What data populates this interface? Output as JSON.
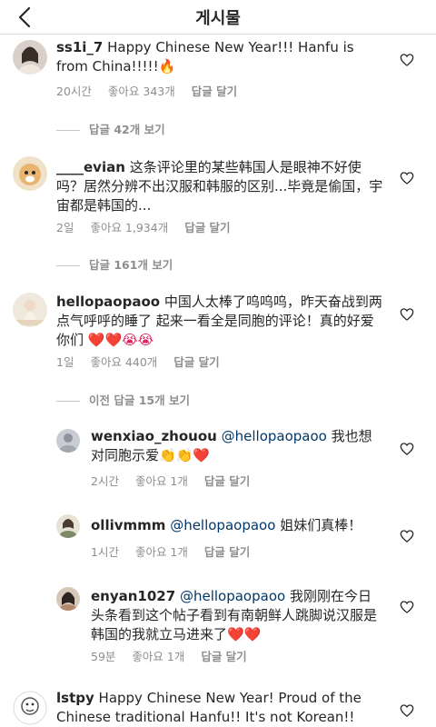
{
  "header": {
    "title": "게시물"
  },
  "comments": [
    {
      "username": "ss1i_7",
      "text": "Happy Chinese New Year!!! Hanfu is from China!!!!!",
      "emoji": "🔥",
      "time": "20시간",
      "likes": "좋아요 343개",
      "reply": "답글 달기",
      "view_replies": "답글 42개 보기"
    },
    {
      "username": "____evian",
      "text": "这条评论里的某些韩国人是眼神不好使吗？居然分辨不出汉服和韩服的区别...毕竟是偷国，宇宙都是韩国的...",
      "time": "2일",
      "likes": "좋아요 1,934개",
      "reply": "답글 달기",
      "view_replies": "답글 161개 보기"
    },
    {
      "username": "hellopaopaoo",
      "text": "中国人太棒了呜呜呜，昨天奋战到两点气呼呼的睡了 起来一看全是同胞的评论！真的好爱你们",
      "emoji": "❤️❤️😭😭",
      "time": "1일",
      "likes": "좋아요 440개",
      "reply": "답글 달기",
      "view_replies": "이전 답글 15개 보기"
    },
    {
      "username": "lstpy",
      "text": "Happy Chinese New Year! Proud of the Chinese traditional Hanfu!! It's not Korean!!"
    }
  ],
  "replies": [
    {
      "username": "wenxiao_zhouou",
      "mention": "@hellopaopaoo",
      "text": "我也想对同胞示爱",
      "emoji": "👏👏❤️",
      "time": "2시간",
      "likes": "좋아요 1개",
      "reply": "답글 달기"
    },
    {
      "username": "ollivmmm",
      "mention": "@hellopaopaoo",
      "text": "姐妹们真棒！",
      "time": "1시간",
      "likes": "좋아요 1개",
      "reply": "답글 달기"
    },
    {
      "username": "enyan1027",
      "mention": "@hellopaopaoo",
      "text": "我刚刚在今日头条看到这个帖子看到有南朝鲜人跳脚说汉服是韩国的我就立马进来了",
      "emoji": "❤️❤️",
      "time": "59분",
      "likes": "좋아요 1개",
      "reply": "답글 달기"
    }
  ],
  "colors": {
    "text": "#262626",
    "meta": "#8e8e8e",
    "mention": "#00376b",
    "divider": "#dbdbdb"
  },
  "icons": {
    "back": "chevron-left-icon",
    "like": "heart-outline-icon"
  }
}
